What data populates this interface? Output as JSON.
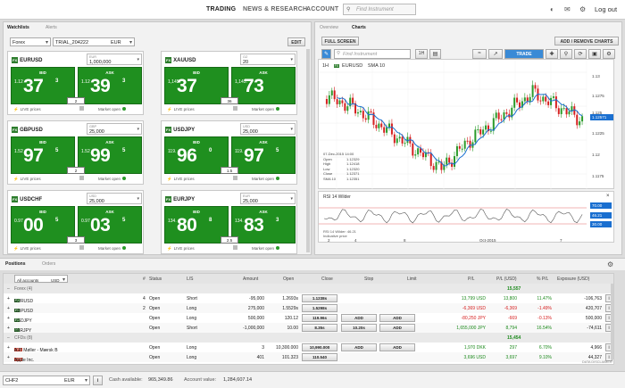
{
  "topnav": {
    "trading": "TRADING",
    "news": "NEWS & RESEARCH",
    "account": "ACCOUNT",
    "search_placeholder": "Find Instrument",
    "logout": "Log out"
  },
  "watchlists": {
    "tab_watchlists": "Watchlists",
    "tab_alerts": "Alerts",
    "list_select": "Forex",
    "account_select": "TRIAL_204222",
    "currency_select": "EUR",
    "edit": "EDIT",
    "tiles": [
      {
        "symbol": "EURUSD",
        "amount_label": "EUR",
        "amount": "1,000,000",
        "bid_small": "1.12",
        "bid_big": "37",
        "bid_sup": "3",
        "ask_small": "1.12",
        "ask_big": "39",
        "ask_sup": "3",
        "spread": "2",
        "live": "LIVE prices",
        "market": "Market open"
      },
      {
        "symbol": "XAUUSD",
        "amount_label": "OZ",
        "amount": "20",
        "bid_small": "1,145.",
        "bid_big": "37",
        "bid_sup": "",
        "ask_small": "1,145.",
        "ask_big": "73",
        "ask_sup": "",
        "spread": "36",
        "live": "LIVE prices",
        "market": "Market open"
      },
      {
        "symbol": "GBPUSD",
        "amount_label": "GBP",
        "amount": "25,000",
        "bid_small": "1.52",
        "bid_big": "97",
        "bid_sup": "5",
        "ask_small": "1.52",
        "ask_big": "99",
        "ask_sup": "5",
        "spread": "2",
        "live": "LIVE prices",
        "market": "Market open"
      },
      {
        "symbol": "USDJPY",
        "amount_label": "USD",
        "amount": "25,000",
        "bid_small": "119.",
        "bid_big": "96",
        "bid_sup": "0",
        "ask_small": "119.",
        "ask_big": "97",
        "ask_sup": "5",
        "spread": "1.5",
        "live": "LIVE prices",
        "market": "Market open"
      },
      {
        "symbol": "USDCHF",
        "amount_label": "USD",
        "amount": "25,000",
        "bid_small": "0.97",
        "bid_big": "00",
        "bid_sup": "5",
        "ask_small": "0.97",
        "ask_big": "03",
        "ask_sup": "5",
        "spread": "3",
        "live": "LIVE prices",
        "market": "Market open"
      },
      {
        "symbol": "EURJPY",
        "amount_label": "EUR",
        "amount": "25,000",
        "bid_small": "134.",
        "bid_big": "80",
        "bid_sup": "8",
        "ask_small": "134.",
        "ask_big": "83",
        "ask_sup": "3",
        "spread": "2.5",
        "live": "LIVE prices",
        "market": "Market open"
      }
    ]
  },
  "charts": {
    "tab_overview": "Overview",
    "tab_charts": "Charts",
    "fullscreen": "FULL SCREEN",
    "add_remove": "ADD / REMOVE CHARTS",
    "find_placeholder": "Find Instrument",
    "period": "1H",
    "trade": "TRADE",
    "legend_period": "1H",
    "legend_symbol": "EURUSD",
    "legend_sma": "SMA 10",
    "ohlc": [
      {
        "k": "07-Dec-2015 14:00",
        "v": ""
      },
      {
        "k": "Open",
        "v": "1.12329"
      },
      {
        "k": "High",
        "v": "1.12418"
      },
      {
        "k": "Low",
        "v": "1.12320"
      },
      {
        "k": "Close",
        "v": "1.12371"
      },
      {
        "k": "SMA 10",
        "v": "1.12351"
      }
    ],
    "price_ticks": [
      "1.13",
      "1.1275",
      "1.125",
      "1.12571",
      "1.1225",
      "1.12",
      "1.1175"
    ],
    "rsi_title": "RSI 14 Wilder",
    "rsi_value": "RSI 14 Wilder: 46.21",
    "indicative": "Indicative price",
    "rsi_ticks": [
      "70.00",
      "46.21",
      "30.00"
    ],
    "x_ticks": [
      "2",
      "4",
      "8",
      "Oct-2015",
      "7"
    ]
  },
  "positions": {
    "tab_positions": "Positions",
    "tab_orders": "Orders",
    "account": "All accounts",
    "currency": "USD",
    "headers": {
      "id": "#",
      "status": "Status",
      "ls": "L/S",
      "amount": "Amount",
      "open": "Open",
      "close": "Close",
      "stop": "Stop",
      "limit": "Limit",
      "pl": "P/L",
      "pleur": "P/L (USD)",
      "pct": "% P/L",
      "exposure": "Exposure (USD)"
    },
    "groups": [
      {
        "label": "Forex (4)",
        "total": "15,557",
        "rows": [
          {
            "sym": "EURUSD",
            "n": "4",
            "status": "Open",
            "ls": "Short",
            "amount": "-95,000",
            "open": "1.2693s",
            "close": "1.1238s",
            "stop": "",
            "limit": "",
            "pl": "13,799 USD",
            "plu": "13,800",
            "pct": "11.47%",
            "exp": "-106,763",
            "cls": "grn"
          },
          {
            "sym": "GBPUSD",
            "n": "2",
            "status": "Open",
            "ls": "Long",
            "amount": "275,000",
            "open": "1.5529s",
            "close": "1.5298s",
            "stop": "",
            "limit": "",
            "pl": "-6,369 USD",
            "plu": "-6,369",
            "pct": "-1.49%",
            "exp": "420,707",
            "cls": "red"
          },
          {
            "sym": "USDJPY",
            "n": "",
            "status": "Open",
            "ls": "Long",
            "amount": "500,000",
            "open": "120.12",
            "close": "119.96s",
            "stop": "ADD",
            "limit": "ADD",
            "pl": "-80,250 JPY",
            "plu": "-669",
            "pct": "-0.13%",
            "exp": "500,000",
            "cls": "red"
          },
          {
            "sym": "ZARJPY",
            "n": "",
            "status": "Open",
            "ls": "Short",
            "amount": "-1,000,000",
            "open": "10.00",
            "close": "8.35s",
            "stop": "10.20s",
            "limit": "ADD",
            "pl": "1,655,000 JPY",
            "plu": "8,794",
            "pct": "16.54%",
            "exp": "-74,611",
            "cls": "grn"
          }
        ]
      },
      {
        "label": "CFDs (8)",
        "total": "15,454",
        "rows": [
          {
            "sym": "A.P. Møller - Mærsk B",
            "n": "",
            "status": "Open",
            "ls": "Long",
            "amount": "3",
            "open": "10,300.000",
            "close": "10,990.000",
            "stop": "ADD",
            "limit": "ADD",
            "pl": "1,970 DKK",
            "plu": "297",
            "pct": "6.70%",
            "exp": "4,966",
            "cls": "grn"
          },
          {
            "sym": "Apple Inc.",
            "n": "",
            "status": "Open",
            "ls": "Long",
            "amount": "401",
            "open": "101.323",
            "close": "110.540",
            "stop": "",
            "limit": "",
            "pl": "3,696 USD",
            "plu": "3,697",
            "pct": "9.10%",
            "exp": "44,327",
            "cls": "grn"
          }
        ]
      }
    ],
    "disclaimer": "DATA DISCLAIMER"
  },
  "footer": {
    "account": "CHF2",
    "currency": "EUR",
    "cash_label": "Cash available:",
    "cash": "965,349.86",
    "value_label": "Account value:",
    "value": "1,284,607.14"
  }
}
